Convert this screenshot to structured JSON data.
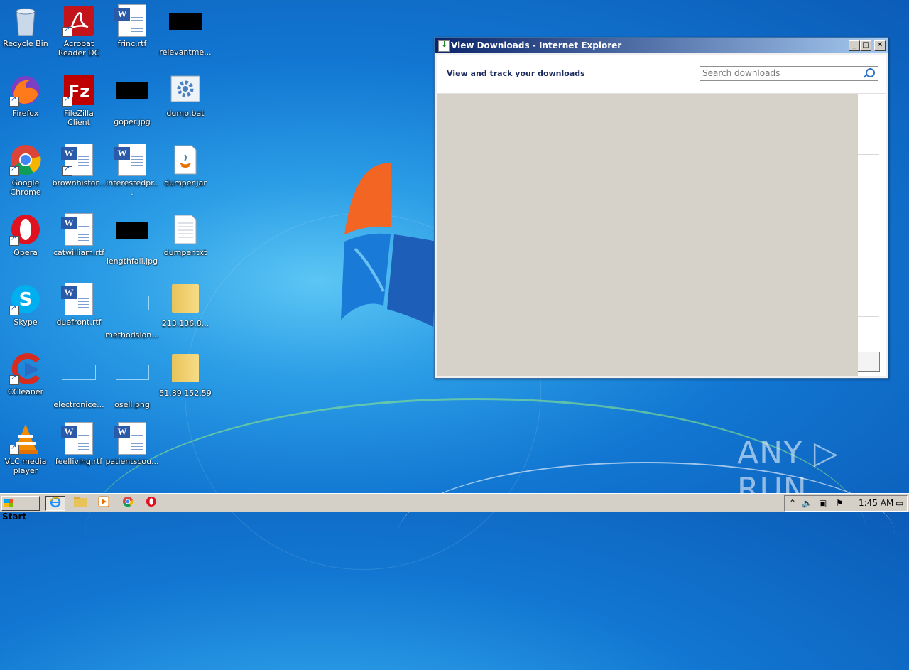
{
  "desktop": {
    "icons": [
      {
        "label": "Recycle Bin"
      },
      {
        "label": "Acrobat Reader DC"
      },
      {
        "label": "frinc.rtf"
      },
      {
        "label": "relevantme..."
      },
      {
        "label": "Firefox"
      },
      {
        "label": "FileZilla Client"
      },
      {
        "label": "goper.jpg"
      },
      {
        "label": "dump.bat"
      },
      {
        "label": "Google Chrome"
      },
      {
        "label": "brownhistor..."
      },
      {
        "label": "interestedpr..."
      },
      {
        "label": "dumper.jar"
      },
      {
        "label": "Opera"
      },
      {
        "label": "catwilliam.rtf"
      },
      {
        "label": "lengthfall.jpg"
      },
      {
        "label": "dumper.txt"
      },
      {
        "label": "Skype"
      },
      {
        "label": "duefront.rtf"
      },
      {
        "label": "methodslon..."
      },
      {
        "label": "213.136.8..."
      },
      {
        "label": "CCleaner"
      },
      {
        "label": "electronice..."
      },
      {
        "label": "osell.png"
      },
      {
        "label": "51.89.152.59"
      },
      {
        "label": "VLC media player"
      },
      {
        "label": "feelliving.rtf"
      },
      {
        "label": "patientscou..."
      }
    ]
  },
  "window": {
    "title": "View Downloads - Internet Explorer",
    "heading": "View and track your downloads",
    "search_placeholder": "Search downloads",
    "buttons": {
      "minimize": "_",
      "maximize": "□",
      "close": "✕"
    }
  },
  "watermark": "ANY ▷ RUN",
  "taskbar": {
    "start_label": "Start",
    "clock": "1:45 AM",
    "pinned": [
      "internet-explorer",
      "windows-explorer",
      "media-player",
      "chrome",
      "opera"
    ]
  }
}
